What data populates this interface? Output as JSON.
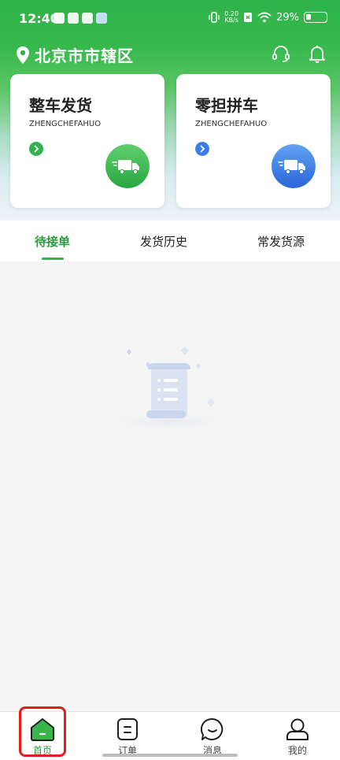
{
  "status_bar": {
    "time": "12:40",
    "net_speed_value": "0.20",
    "net_speed_unit": "KB/s",
    "battery_percent": "29%",
    "battery_level": 0.29
  },
  "header": {
    "location": "北京市市辖区"
  },
  "cards": [
    {
      "title": "整车发货",
      "subtitle": "ZHENGCHEFAHUO",
      "accent": "#2fb34a"
    },
    {
      "title": "零担拼车",
      "subtitle": "ZHENGCHEFAHUO",
      "accent": "#3b7de6"
    }
  ],
  "tabs": [
    {
      "label": "待接单",
      "active": true
    },
    {
      "label": "发货历史",
      "active": false
    },
    {
      "label": "常发货源",
      "active": false
    }
  ],
  "bottom_nav": [
    {
      "label": "首页",
      "icon": "home-icon",
      "active": true
    },
    {
      "label": "订单",
      "icon": "order-icon",
      "active": false
    },
    {
      "label": "消息",
      "icon": "message-icon",
      "active": false
    },
    {
      "label": "我的",
      "icon": "profile-icon",
      "active": false
    }
  ],
  "colors": {
    "brand_green": "#2fb34a",
    "brand_blue": "#3b7de6",
    "highlight_red": "#e21d1d"
  }
}
